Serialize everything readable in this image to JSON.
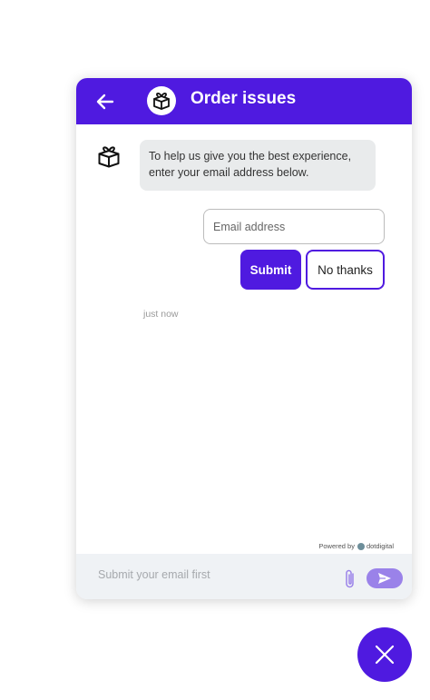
{
  "header": {
    "title": "Order issues",
    "back_icon": "arrow-left-icon",
    "avatar_icon": "gift-box-icon",
    "background": "#4f1ae0"
  },
  "conversation": {
    "bot_message": "To help us give you the best experience, enter your email address below.",
    "email_placeholder": "Email address",
    "submit_label": "Submit",
    "no_thanks_label": "No thanks",
    "timestamp": "just now"
  },
  "branding": {
    "powered_by_label": "Powered by",
    "brand_name": "dotdigital"
  },
  "composer": {
    "placeholder": "Submit your email first",
    "attach_icon": "paperclip-icon",
    "send_icon": "send-icon"
  },
  "launcher": {
    "icon": "close-icon"
  },
  "colors": {
    "accent": "#4f1ae0",
    "bubble": "#e9ebec",
    "send_disabled": "#9a82e9"
  }
}
